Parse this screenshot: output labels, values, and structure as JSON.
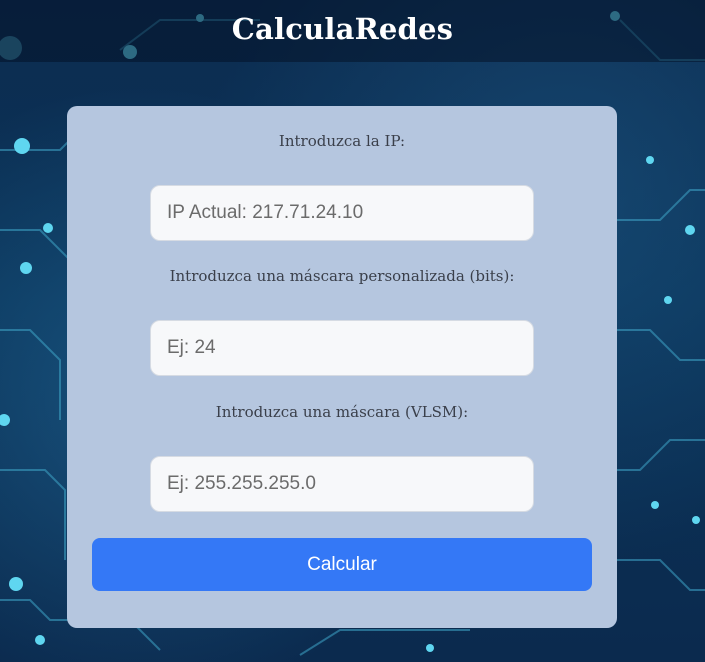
{
  "app": {
    "title": "CalculaRedes"
  },
  "form": {
    "ip_label": "Introduzca la IP:",
    "ip_placeholder": "IP Actual: 217.71.24.10",
    "bits_label": "Introduzca una máscara personalizada (bits):",
    "bits_placeholder": "Ej: 24",
    "vlsm_label": "Introduzca una máscara (VLSM):",
    "vlsm_placeholder": "Ej: 255.255.255.0",
    "submit_label": "Calcular"
  },
  "colors": {
    "card_background": "#b5c6df",
    "button_accent": "#3478f6",
    "page_background": "#0b2545"
  }
}
